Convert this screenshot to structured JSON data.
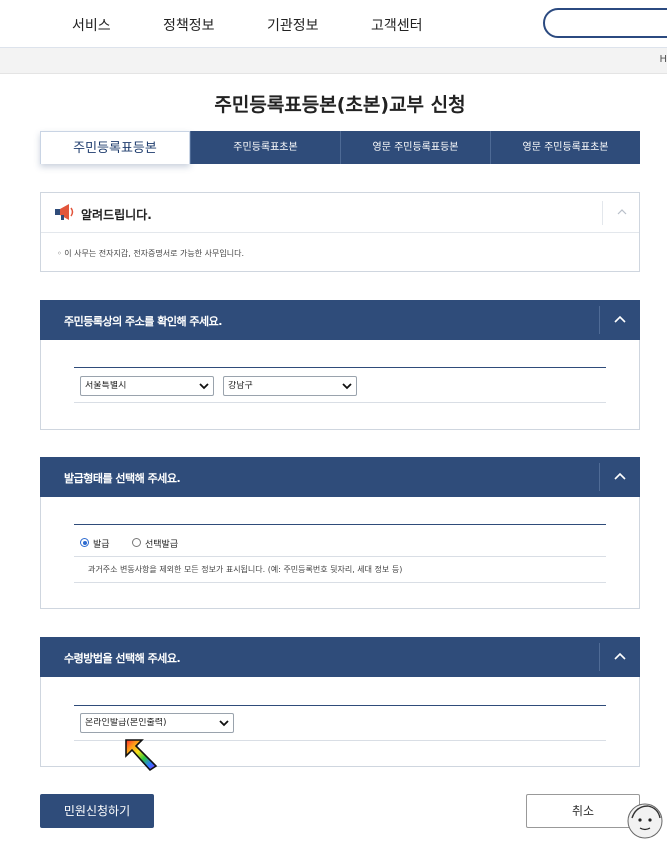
{
  "gnb": {
    "items": [
      {
        "label": "서비스"
      },
      {
        "label": "정책정보"
      },
      {
        "label": "기관정보"
      },
      {
        "label": "고객센터"
      }
    ],
    "search_icon": "search-field"
  },
  "breadcrumb": {
    "home_label": "H"
  },
  "page_title": "주민등록표등본(초본)교부 신청",
  "tabs": [
    {
      "label": "주민등록표등본",
      "active": true
    },
    {
      "label": "주민등록표초본",
      "active": false
    },
    {
      "label": "영문 주민등록표등본",
      "active": false
    },
    {
      "label": "영문 주민등록표초본",
      "active": false
    }
  ],
  "notice": {
    "icon": "megaphone-icon",
    "title": "알려드립니다.",
    "text": "◦ 이 사무는 전자지갑, 전자증명서로 가능한 사무입니다."
  },
  "address_section": {
    "title": "주민등록상의 주소를 확인해 주세요.",
    "city": {
      "selected": "서울특별시",
      "options": [
        "서울특별시"
      ]
    },
    "district": {
      "selected": "강남구",
      "options": [
        "강남구"
      ]
    }
  },
  "issue_section": {
    "title": "발급형태를 선택해 주세요.",
    "options": [
      {
        "label": "발급",
        "checked": true
      },
      {
        "label": "선택발급",
        "checked": false
      }
    ],
    "description": "과거주소 변동사항을 제외한 모든 정보가 표시됩니다. (예: 주민등록번호 뒷자리, 세대 정보 등)"
  },
  "receive_section": {
    "title": "수령방법을 선택해 주세요.",
    "method": {
      "selected": "온라인발급(본인출력)",
      "options": [
        "온라인발급(본인출력)"
      ]
    }
  },
  "buttons": {
    "submit": "민원신청하기",
    "cancel": "취소"
  },
  "colors": {
    "primary": "#2f4c7a",
    "radio_accent": "#2e6bd0"
  }
}
